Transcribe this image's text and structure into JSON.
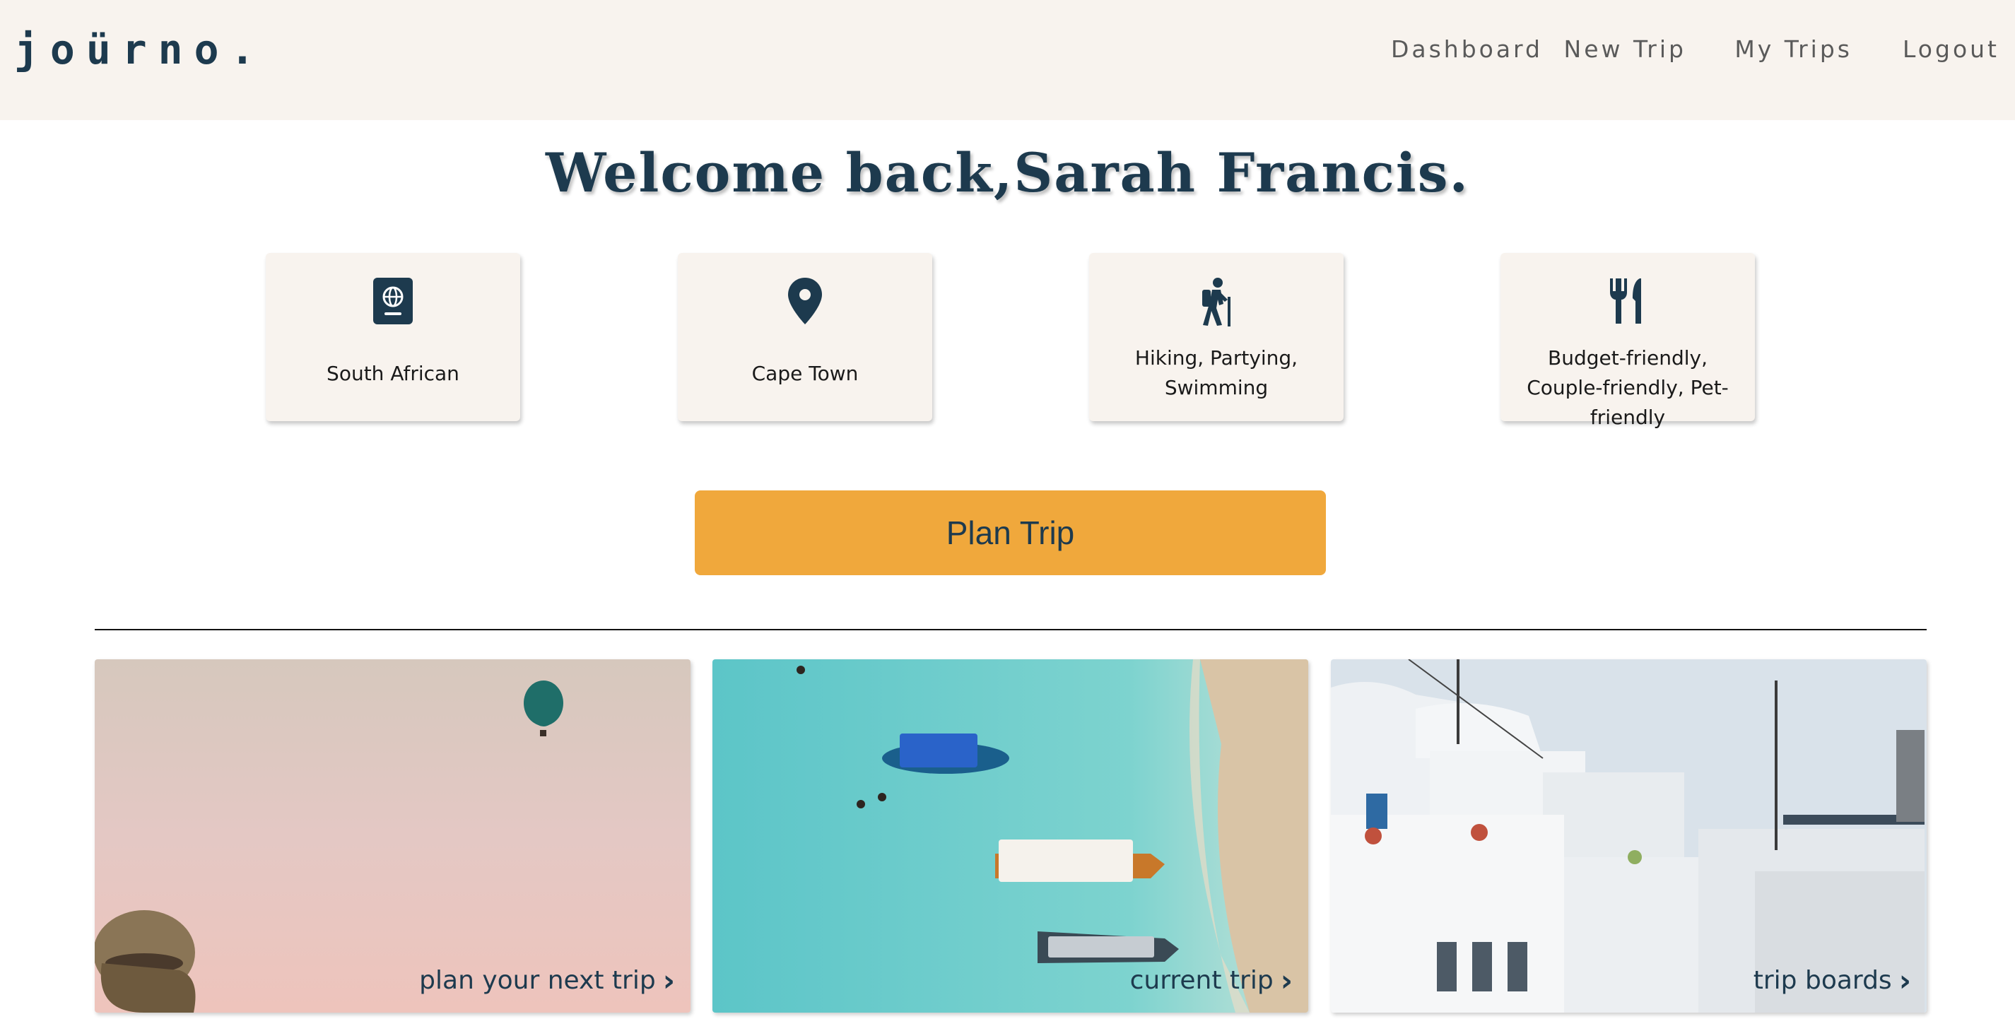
{
  "header": {
    "logo": "joürno.",
    "nav": [
      "Dashboard",
      "New Trip",
      "My Trips",
      "Logout"
    ]
  },
  "welcome": "Welcome back,Sarah Francis.",
  "profile_cards": [
    {
      "icon": "passport-icon",
      "label": "South African"
    },
    {
      "icon": "location-pin-icon",
      "label": "Cape Town"
    },
    {
      "icon": "hiker-icon",
      "label": "Hiking, Partying, Swimming"
    },
    {
      "icon": "utensils-icon",
      "label": "Budget-friendly, Couple-friendly, Pet-friendly"
    }
  ],
  "plan_button": "Plan Trip",
  "tiles": [
    {
      "caption": "plan your next trip"
    },
    {
      "caption": "current trip"
    },
    {
      "caption": "trip boards"
    }
  ],
  "colors": {
    "primary": "#1d3a4e",
    "accent": "#f0a83c",
    "header_bg": "#f8f3ee"
  }
}
